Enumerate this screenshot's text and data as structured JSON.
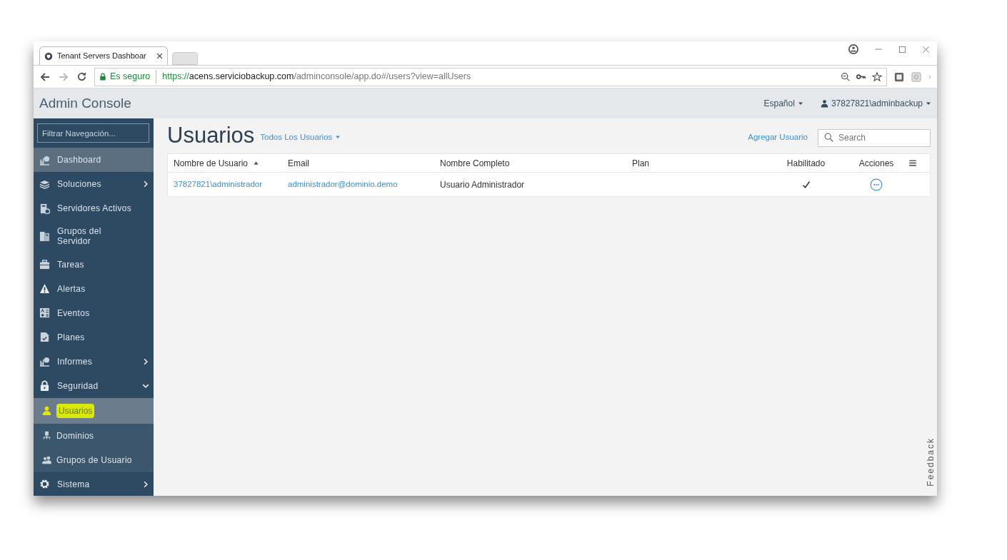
{
  "browser": {
    "tab_title": "Tenant Servers Dashboar",
    "security": "Es seguro",
    "url": {
      "scheme": "https://",
      "host": "acens.serviciobackup.com",
      "path": "/adminconsole/app.do#/users?view=allUsers"
    }
  },
  "header": {
    "title": "Admin Console",
    "language": "Español",
    "user": "37827821\\adminbackup"
  },
  "sidebar": {
    "filter": {
      "placeholder": "Filtrar Navegación..."
    },
    "items": [
      {
        "kind": "chart",
        "label": "Dashboard",
        "hovered": true,
        "has_submenu": false
      },
      {
        "kind": "layers",
        "label": "Soluciones",
        "hovered": false,
        "has_submenu": true,
        "expanded": false
      },
      {
        "kind": "server",
        "label": "Servidores Activos",
        "hovered": false,
        "has_submenu": false
      },
      {
        "kind": "servers",
        "label": "Grupos del Servidor",
        "hovered": false,
        "has_submenu": false
      },
      {
        "kind": "briefcase",
        "label": "Tareas",
        "hovered": false,
        "has_submenu": false
      },
      {
        "kind": "warning",
        "label": "Alertas",
        "hovered": false,
        "has_submenu": false
      },
      {
        "kind": "events",
        "label": "Eventos",
        "hovered": false,
        "has_submenu": false
      },
      {
        "kind": "document",
        "label": "Planes",
        "hovered": false,
        "has_submenu": false
      },
      {
        "kind": "chart",
        "label": "Informes",
        "hovered": false,
        "has_submenu": true,
        "expanded": false
      },
      {
        "kind": "lock",
        "label": "Seguridad",
        "hovered": false,
        "has_submenu": true,
        "expanded": true,
        "children": [
          {
            "kind": "user",
            "label": "Usuarios",
            "selected": true,
            "marked": true
          },
          {
            "kind": "network",
            "label": "Dominios",
            "selected": false,
            "marked": false
          },
          {
            "kind": "users",
            "label": "Grupos de Usuario",
            "selected": false,
            "marked": false
          }
        ]
      },
      {
        "kind": "gear",
        "label": "Sistema",
        "hovered": false,
        "has_submenu": true,
        "expanded": false
      }
    ]
  },
  "page": {
    "title": "Usuarios",
    "view": "Todos Los Usuarios",
    "add_link": "Agregar Usuario",
    "search": {
      "placeholder": "Search"
    },
    "table": {
      "columns": [
        {
          "label": "Nombre de Usuario",
          "sorted": true
        },
        {
          "label": "Email",
          "sorted": false
        },
        {
          "label": "Nombre Completo",
          "sorted": false
        },
        {
          "label": "Plan",
          "sorted": false
        },
        {
          "label": "Habilitado",
          "sorted": false
        },
        {
          "label": "Acciones",
          "sorted": false
        }
      ],
      "rows": [
        {
          "username": "37827821\\administrador",
          "email": "administrador@dominio.demo",
          "full_name": "Usuario Administrador",
          "enabled": true
        }
      ]
    }
  },
  "feedback": "Feedback"
}
